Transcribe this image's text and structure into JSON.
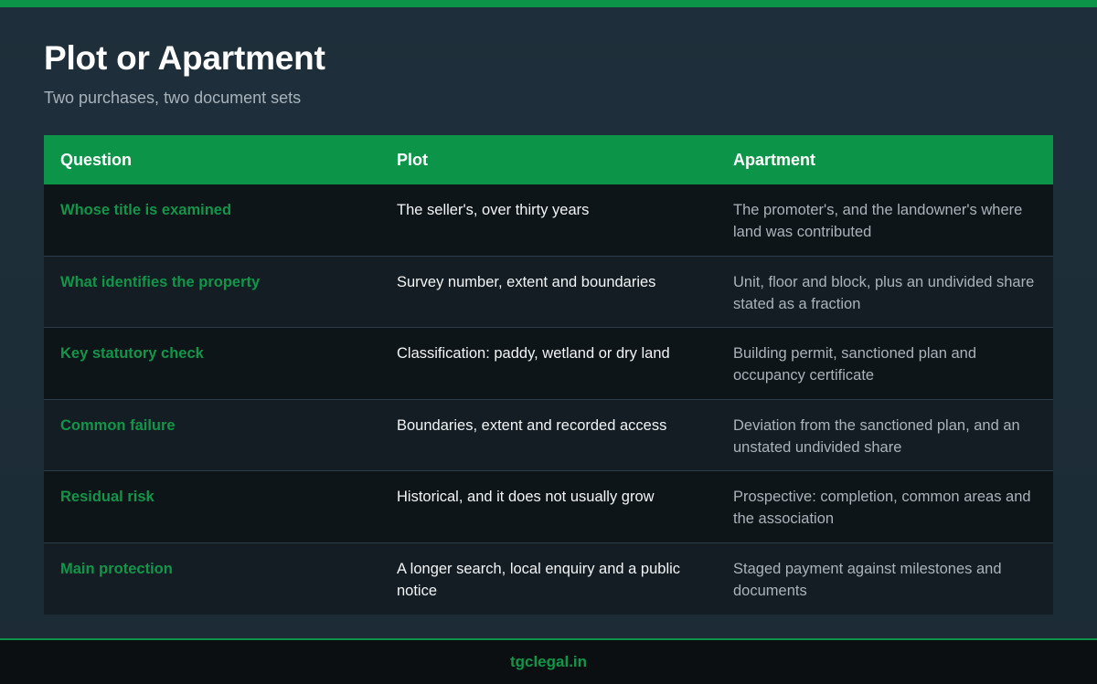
{
  "header": {
    "title": "Plot or Apartment",
    "subtitle": "Two purchases, two document sets"
  },
  "table": {
    "columns": [
      "Question",
      "Plot",
      "Apartment"
    ],
    "rows": [
      {
        "question": "Whose title is examined",
        "plot": "The seller's, over thirty years",
        "apartment": "The promoter's, and the landowner's where land was contributed"
      },
      {
        "question": "What identifies the property",
        "plot": "Survey number, extent and boundaries",
        "apartment": "Unit, floor and block, plus an undivided share stated as a fraction"
      },
      {
        "question": "Key statutory check",
        "plot": "Classification: paddy, wetland or dry land",
        "apartment": "Building permit, sanctioned plan and occupancy certificate"
      },
      {
        "question": "Common failure",
        "plot": "Boundaries, extent and recorded access",
        "apartment": "Deviation from the sanctioned plan, and an unstated undivided share"
      },
      {
        "question": "Residual risk",
        "plot": "Historical, and it does not usually grow",
        "apartment": "Prospective: completion, common areas and the association"
      },
      {
        "question": "Main protection",
        "plot": "A longer search, local enquiry and a public notice",
        "apartment": "Staged payment against milestones and documents"
      }
    ]
  },
  "footer": {
    "site": "tgclegal.in"
  },
  "colors": {
    "accent": "#0c9448",
    "accent_text": "#129548",
    "background": "#1e2f3b"
  }
}
